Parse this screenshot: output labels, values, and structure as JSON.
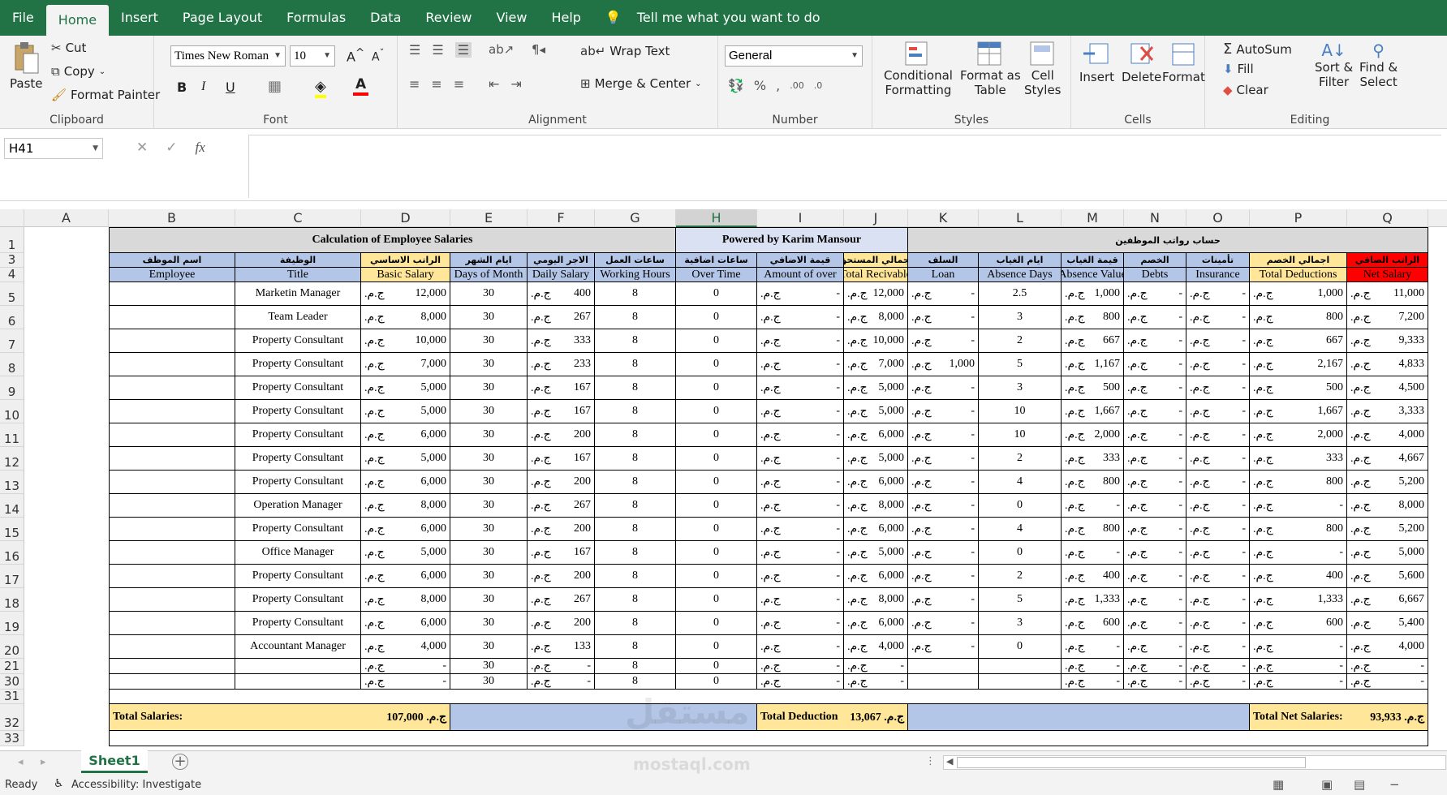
{
  "ribbon_tabs": [
    "File",
    "Home",
    "Insert",
    "Page Layout",
    "Formulas",
    "Data",
    "Review",
    "View",
    "Help"
  ],
  "tell_me": "Tell me what you want to do",
  "clipboard": {
    "paste": "Paste",
    "cut": "Cut",
    "copy": "Copy",
    "format_painter": "Format Painter",
    "label": "Clipboard"
  },
  "font": {
    "name": "Times New Roman",
    "size": "10",
    "label": "Font",
    "bold": "B",
    "italic": "I",
    "underline": "U",
    "font_color": "A"
  },
  "alignment": {
    "wrap": "Wrap Text",
    "merge": "Merge & Center",
    "label": "Alignment"
  },
  "number": {
    "format": "General",
    "label": "Number",
    "percent": "%",
    "comma": ","
  },
  "styles": {
    "conditional": "Conditional",
    "conditional2": "Formatting",
    "format_table": "Format as",
    "format_table2": "Table",
    "cell_styles": "Cell",
    "cell_styles2": "Styles",
    "label": "Styles"
  },
  "cells": {
    "insert": "Insert",
    "delete": "Delete",
    "format": "Format",
    "label": "Cells"
  },
  "editing": {
    "autosum": "AutoSum",
    "fill": "Fill",
    "clear": "Clear",
    "sort": "Sort &",
    "sort2": "Filter",
    "find": "Find &",
    "find2": "Select",
    "label": "Editing"
  },
  "name_box": "H41",
  "columns": [
    "A",
    "B",
    "C",
    "D",
    "E",
    "F",
    "G",
    "H",
    "I",
    "J",
    "K",
    "L",
    "M",
    "N",
    "O",
    "P",
    "Q"
  ],
  "selected_column": "H",
  "titles": {
    "left": "Calculation of Employee Salaries",
    "middle": "Powered by Karim Mansour",
    "right": "حساب رواتب الموظفين"
  },
  "headers_ar": [
    "اسم الموظف",
    "الوظيفة",
    "الراتب الاساسي",
    "ايام الشهر",
    "الاجر اليومي",
    "ساعات العمل",
    "ساعات اضافية",
    "قيمة الاضافي",
    "اجمالي المستحق",
    "السلف",
    "ايام الغياب",
    "قيمة الغياب",
    "الخصم",
    "تأمينات",
    "اجمالي الخصم",
    "الراتب الصافي"
  ],
  "headers_en": [
    "Employee",
    "Title",
    "Basic Salary",
    "Days of Month",
    "Daily Salary",
    "Working Hours",
    "Over Time",
    "Amount of over",
    "Total Recivable",
    "Loan",
    "Absence Days",
    "Absence Value",
    "Debts",
    "Insurance",
    "Total Deductions",
    "Net Salary"
  ],
  "currency": "ج.م.",
  "rows": [
    {
      "n": "5",
      "t": "Marketin Manager",
      "b": "12,000",
      "d": "30",
      "ds": "400",
      "wh": "8",
      "ot": "0",
      "ao": "-",
      "tr": "12,000",
      "lo": "-",
      "ad": "2.5",
      "av": "1,000",
      "de": "-",
      "in": "-",
      "td": "1,000",
      "ns": "11,000"
    },
    {
      "n": "6",
      "t": "Team Leader",
      "b": "8,000",
      "d": "30",
      "ds": "267",
      "wh": "8",
      "ot": "0",
      "ao": "-",
      "tr": "8,000",
      "lo": "-",
      "ad": "3",
      "av": "800",
      "de": "-",
      "in": "-",
      "td": "800",
      "ns": "7,200"
    },
    {
      "n": "7",
      "t": "Property Consultant",
      "b": "10,000",
      "d": "30",
      "ds": "333",
      "wh": "8",
      "ot": "0",
      "ao": "-",
      "tr": "10,000",
      "lo": "-",
      "ad": "2",
      "av": "667",
      "de": "-",
      "in": "-",
      "td": "667",
      "ns": "9,333"
    },
    {
      "n": "8",
      "t": "Property Consultant",
      "b": "7,000",
      "d": "30",
      "ds": "233",
      "wh": "8",
      "ot": "0",
      "ao": "-",
      "tr": "7,000",
      "lo": "1,000",
      "ad": "5",
      "av": "1,167",
      "de": "-",
      "in": "-",
      "td": "2,167",
      "ns": "4,833"
    },
    {
      "n": "9",
      "t": "Property Consultant",
      "b": "5,000",
      "d": "30",
      "ds": "167",
      "wh": "8",
      "ot": "0",
      "ao": "-",
      "tr": "5,000",
      "lo": "-",
      "ad": "3",
      "av": "500",
      "de": "-",
      "in": "-",
      "td": "500",
      "ns": "4,500"
    },
    {
      "n": "10",
      "t": "Property Consultant",
      "b": "5,000",
      "d": "30",
      "ds": "167",
      "wh": "8",
      "ot": "0",
      "ao": "-",
      "tr": "5,000",
      "lo": "-",
      "ad": "10",
      "av": "1,667",
      "de": "-",
      "in": "-",
      "td": "1,667",
      "ns": "3,333"
    },
    {
      "n": "11",
      "t": "Property Consultant",
      "b": "6,000",
      "d": "30",
      "ds": "200",
      "wh": "8",
      "ot": "0",
      "ao": "-",
      "tr": "6,000",
      "lo": "-",
      "ad": "10",
      "av": "2,000",
      "de": "-",
      "in": "-",
      "td": "2,000",
      "ns": "4,000"
    },
    {
      "n": "12",
      "t": "Property Consultant",
      "b": "5,000",
      "d": "30",
      "ds": "167",
      "wh": "8",
      "ot": "0",
      "ao": "-",
      "tr": "5,000",
      "lo": "-",
      "ad": "2",
      "av": "333",
      "de": "-",
      "in": "-",
      "td": "333",
      "ns": "4,667"
    },
    {
      "n": "13",
      "t": "Property Consultant",
      "b": "6,000",
      "d": "30",
      "ds": "200",
      "wh": "8",
      "ot": "0",
      "ao": "-",
      "tr": "6,000",
      "lo": "-",
      "ad": "4",
      "av": "800",
      "de": "-",
      "in": "-",
      "td": "800",
      "ns": "5,200"
    },
    {
      "n": "14",
      "t": "Operation Manager",
      "b": "8,000",
      "d": "30",
      "ds": "267",
      "wh": "8",
      "ot": "0",
      "ao": "-",
      "tr": "8,000",
      "lo": "-",
      "ad": "0",
      "av": "-",
      "de": "-",
      "in": "-",
      "td": "-",
      "ns": "8,000"
    },
    {
      "n": "15",
      "t": "Property Consultant",
      "b": "6,000",
      "d": "30",
      "ds": "200",
      "wh": "8",
      "ot": "0",
      "ao": "-",
      "tr": "6,000",
      "lo": "-",
      "ad": "4",
      "av": "800",
      "de": "-",
      "in": "-",
      "td": "800",
      "ns": "5,200"
    },
    {
      "n": "16",
      "t": "Office Manager",
      "b": "5,000",
      "d": "30",
      "ds": "167",
      "wh": "8",
      "ot": "0",
      "ao": "-",
      "tr": "5,000",
      "lo": "-",
      "ad": "0",
      "av": "-",
      "de": "-",
      "in": "-",
      "td": "-",
      "ns": "5,000"
    },
    {
      "n": "17",
      "t": "Property Consultant",
      "b": "6,000",
      "d": "30",
      "ds": "200",
      "wh": "8",
      "ot": "0",
      "ao": "-",
      "tr": "6,000",
      "lo": "-",
      "ad": "2",
      "av": "400",
      "de": "-",
      "in": "-",
      "td": "400",
      "ns": "5,600"
    },
    {
      "n": "18",
      "t": "Property Consultant",
      "b": "8,000",
      "d": "30",
      "ds": "267",
      "wh": "8",
      "ot": "0",
      "ao": "-",
      "tr": "8,000",
      "lo": "-",
      "ad": "5",
      "av": "1,333",
      "de": "-",
      "in": "-",
      "td": "1,333",
      "ns": "6,667"
    },
    {
      "n": "19",
      "t": "Property Consultant",
      "b": "6,000",
      "d": "30",
      "ds": "200",
      "wh": "8",
      "ot": "0",
      "ao": "-",
      "tr": "6,000",
      "lo": "-",
      "ad": "3",
      "av": "600",
      "de": "-",
      "in": "-",
      "td": "600",
      "ns": "5,400"
    },
    {
      "n": "20",
      "t": "Accountant Manager",
      "b": "4,000",
      "d": "30",
      "ds": "133",
      "wh": "8",
      "ot": "0",
      "ao": "-",
      "tr": "4,000",
      "lo": "-",
      "ad": "0",
      "av": "-",
      "de": "-",
      "in": "-",
      "td": "-",
      "ns": "4,000"
    },
    {
      "n": "21",
      "t": "",
      "b": "-",
      "d": "30",
      "ds": "-",
      "wh": "8",
      "ot": "0",
      "ao": "-",
      "tr": "-",
      "lo": "",
      "ad": "",
      "av": "-",
      "de": "-",
      "in": "-",
      "td": "-",
      "ns": "-"
    },
    {
      "n": "30",
      "t": "",
      "b": "-",
      "d": "30",
      "ds": "-",
      "wh": "8",
      "ot": "0",
      "ao": "-",
      "tr": "-",
      "lo": "",
      "ad": "",
      "av": "-",
      "de": "-",
      "in": "-",
      "td": "-",
      "ns": "-"
    }
  ],
  "row_numbers_extra": [
    "1",
    "3",
    "4",
    "31",
    "32",
    "33"
  ],
  "totals": {
    "salaries_label": "Total Salaries:",
    "salaries": "107,000",
    "deduction_label": "Total Deduction",
    "deduction": "13,067",
    "net_label": "Total Net Salaries:",
    "net": "93,933"
  },
  "sheet_tab": "Sheet1",
  "status": {
    "ready": "Ready",
    "accessibility": "Accessibility: Investigate"
  },
  "watermark": "mostaql.com",
  "colors": {
    "excel_green": "#217346",
    "hdr_blue": "#b4c6e7",
    "hdr_yellow": "#ffe699",
    "hdr_red": "#ff0000",
    "title_grey": "#d9d9d9",
    "title_lav": "#d9e1f2"
  }
}
